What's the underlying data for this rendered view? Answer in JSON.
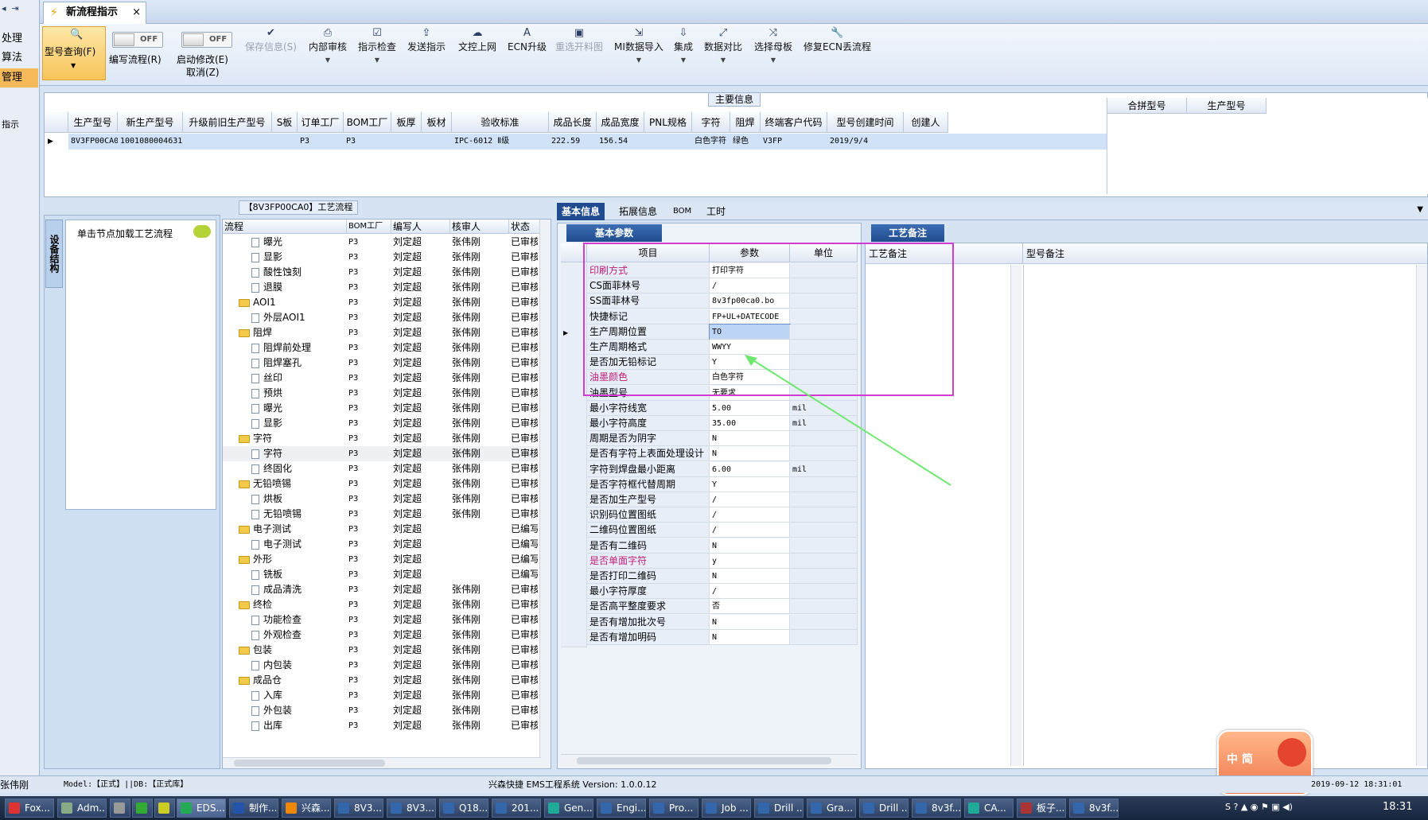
{
  "left_strip": [
    "处理",
    "算法",
    "管理",
    "指示"
  ],
  "tab": {
    "title": "新流程指示",
    "close": "×"
  },
  "toolbar": {
    "query": "型号查询(F)",
    "write_flow": "编写流程(R)",
    "start_modify": "启动修改(E)",
    "cancel": "取消(Z)",
    "off": "OFF",
    "save": "保存信息(S)",
    "internal_review": "内部审核",
    "check": "指示检查",
    "send": "发送指示",
    "upload": "文控上网",
    "ecn": "ECN升级",
    "reselect": "重选开料图",
    "mi_import": "MI数据导入",
    "integrate": "集成",
    "compare": "数据对比",
    "choose_board": "选择母板",
    "repair_ecn": "修复ECN丢流程"
  },
  "main_info": {
    "label": "主要信息",
    "headers": [
      "生产型号",
      "新生产型号",
      "升级前旧生产型号",
      "S板",
      "订单工厂",
      "BOM工厂",
      "板厚",
      "板材",
      "验收标准",
      "成品长度",
      "成品宽度",
      "PNL规格",
      "字符",
      "阻焊",
      "终端客户代码",
      "型号创建时间",
      "创建人"
    ],
    "row": [
      "8V3FP00CA0",
      "10010800046315",
      "",
      "",
      "P3",
      "P3",
      "",
      "",
      "IPC-6012 Ⅱ级",
      "222.59",
      "156.54",
      "",
      "白色字符",
      "绿色",
      "V3FP",
      "2019/9/4",
      ""
    ],
    "right_headers": [
      "合拼型号",
      "生产型号"
    ]
  },
  "tree": {
    "vtab": "设备结构",
    "node_hint": "单击节点加载工艺流程"
  },
  "flow": {
    "title": "【8V3FP00CA0】工艺流程",
    "headers": [
      "流程",
      "BOM工厂",
      "编写人",
      "核审人",
      "状态"
    ],
    "rows": [
      {
        "name": "曝光",
        "type": "doc",
        "bom": "P3",
        "writer": "刘定超",
        "checker": "张伟刚",
        "state": "已审核"
      },
      {
        "name": "显影",
        "type": "doc",
        "bom": "P3",
        "writer": "刘定超",
        "checker": "张伟刚",
        "state": "已审核"
      },
      {
        "name": "酸性蚀刻",
        "type": "doc",
        "bom": "P3",
        "writer": "刘定超",
        "checker": "张伟刚",
        "state": "已审核"
      },
      {
        "name": "退膜",
        "type": "doc",
        "bom": "P3",
        "writer": "刘定超",
        "checker": "张伟刚",
        "state": "已审核"
      },
      {
        "name": "AOI1",
        "type": "folder",
        "bom": "P3",
        "writer": "刘定超",
        "checker": "张伟刚",
        "state": "已审核"
      },
      {
        "name": "外层AOI1",
        "type": "doc",
        "bom": "P3",
        "writer": "刘定超",
        "checker": "张伟刚",
        "state": "已审核"
      },
      {
        "name": "阻焊",
        "type": "folder",
        "bom": "P3",
        "writer": "刘定超",
        "checker": "张伟刚",
        "state": "已审核"
      },
      {
        "name": "阻焊前处理",
        "type": "doc",
        "bom": "P3",
        "writer": "刘定超",
        "checker": "张伟刚",
        "state": "已审核"
      },
      {
        "name": "阻焊塞孔",
        "type": "doc",
        "bom": "P3",
        "writer": "刘定超",
        "checker": "张伟刚",
        "state": "已审核"
      },
      {
        "name": "丝印",
        "type": "doc",
        "bom": "P3",
        "writer": "刘定超",
        "checker": "张伟刚",
        "state": "已审核"
      },
      {
        "name": "预烘",
        "type": "doc",
        "bom": "P3",
        "writer": "刘定超",
        "checker": "张伟刚",
        "state": "已审核"
      },
      {
        "name": "曝光",
        "type": "doc",
        "bom": "P3",
        "writer": "刘定超",
        "checker": "张伟刚",
        "state": "已审核"
      },
      {
        "name": "显影",
        "type": "doc",
        "bom": "P3",
        "writer": "刘定超",
        "checker": "张伟刚",
        "state": "已审核"
      },
      {
        "name": "字符",
        "type": "folder",
        "bom": "P3",
        "writer": "刘定超",
        "checker": "张伟刚",
        "state": "已审核"
      },
      {
        "name": "字符",
        "type": "doc",
        "bom": "P3",
        "writer": "刘定超",
        "checker": "张伟刚",
        "state": "已审核"
      },
      {
        "name": "终固化",
        "type": "doc",
        "bom": "P3",
        "writer": "刘定超",
        "checker": "张伟刚",
        "state": "已审核"
      },
      {
        "name": "无铅喷锡",
        "type": "folder",
        "bom": "P3",
        "writer": "刘定超",
        "checker": "张伟刚",
        "state": "已审核"
      },
      {
        "name": "烘板",
        "type": "doc",
        "bom": "P3",
        "writer": "刘定超",
        "checker": "张伟刚",
        "state": "已审核"
      },
      {
        "name": "无铅喷锡",
        "type": "doc",
        "bom": "P3",
        "writer": "刘定超",
        "checker": "张伟刚",
        "state": "已审核"
      },
      {
        "name": "电子测试",
        "type": "folder",
        "bom": "P3",
        "writer": "刘定超",
        "checker": "",
        "state": "已编写"
      },
      {
        "name": "电子测试",
        "type": "doc",
        "bom": "P3",
        "writer": "刘定超",
        "checker": "",
        "state": "已编写"
      },
      {
        "name": "外形",
        "type": "folder",
        "bom": "P3",
        "writer": "刘定超",
        "checker": "",
        "state": "已编写"
      },
      {
        "name": "铣板",
        "type": "doc",
        "bom": "P3",
        "writer": "刘定超",
        "checker": "",
        "state": "已编写"
      },
      {
        "name": "成品清洗",
        "type": "doc",
        "bom": "P3",
        "writer": "刘定超",
        "checker": "张伟刚",
        "state": "已审核"
      },
      {
        "name": "终检",
        "type": "folder",
        "bom": "P3",
        "writer": "刘定超",
        "checker": "张伟刚",
        "state": "已审核"
      },
      {
        "name": "功能检查",
        "type": "doc",
        "bom": "P3",
        "writer": "刘定超",
        "checker": "张伟刚",
        "state": "已审核"
      },
      {
        "name": "外观检查",
        "type": "doc",
        "bom": "P3",
        "writer": "刘定超",
        "checker": "张伟刚",
        "state": "已审核"
      },
      {
        "name": "包装",
        "type": "folder",
        "bom": "P3",
        "writer": "刘定超",
        "checker": "张伟刚",
        "state": "已审核"
      },
      {
        "name": "内包装",
        "type": "doc",
        "bom": "P3",
        "writer": "刘定超",
        "checker": "张伟刚",
        "state": "已审核"
      },
      {
        "name": "成品仓",
        "type": "folder",
        "bom": "P3",
        "writer": "刘定超",
        "checker": "张伟刚",
        "state": "已审核"
      },
      {
        "name": "入库",
        "type": "doc",
        "bom": "P3",
        "writer": "刘定超",
        "checker": "张伟刚",
        "state": "已审核"
      },
      {
        "name": "外包装",
        "type": "doc",
        "bom": "P3",
        "writer": "刘定超",
        "checker": "张伟刚",
        "state": "已审核"
      },
      {
        "name": "出库",
        "type": "doc",
        "bom": "P3",
        "writer": "刘定超",
        "checker": "张伟刚",
        "state": "已审核"
      }
    ]
  },
  "info_tabs": [
    "基本信息",
    "拓展信息",
    "BOM",
    "工时"
  ],
  "basic": {
    "header": "基本参数",
    "cols": [
      "项目",
      "参数",
      "单位"
    ],
    "rows": [
      {
        "k": "印刷方式",
        "v": "打印字符",
        "u": "",
        "pink": true
      },
      {
        "k": "CS面菲林号",
        "v": "/",
        "u": ""
      },
      {
        "k": "SS面菲林号",
        "v": "8v3fp00ca0.bo",
        "u": ""
      },
      {
        "k": "快捷标记",
        "v": "FP+UL+DATECODE",
        "u": ""
      },
      {
        "k": "生产周期位置",
        "v": "TO",
        "u": "",
        "sel": true
      },
      {
        "k": "生产周期格式",
        "v": "WWYY",
        "u": ""
      },
      {
        "k": "是否加无铅标记",
        "v": "Y",
        "u": ""
      },
      {
        "k": "油墨颜色",
        "v": "白色字符",
        "u": "",
        "pink": true
      },
      {
        "k": "油墨型号",
        "v": "无要求",
        "u": ""
      },
      {
        "k": "最小字符线宽",
        "v": "5.00",
        "u": "mil"
      },
      {
        "k": "最小字符高度",
        "v": "35.00",
        "u": "mil"
      },
      {
        "k": "周期是否为阴字",
        "v": "N",
        "u": ""
      },
      {
        "k": "是否有字符上表面处理设计",
        "v": "N",
        "u": ""
      },
      {
        "k": "字符到焊盘最小距离",
        "v": "6.00",
        "u": "mil"
      },
      {
        "k": "是否字符框代替周期",
        "v": "Y",
        "u": ""
      },
      {
        "k": "是否加生产型号",
        "v": "/",
        "u": ""
      },
      {
        "k": "识别码位置图纸",
        "v": "/",
        "u": ""
      },
      {
        "k": "二维码位置图纸",
        "v": "/",
        "u": ""
      },
      {
        "k": "是否有二维码",
        "v": "N",
        "u": ""
      },
      {
        "k": "是否单面字符",
        "v": "y",
        "u": "",
        "pink": true
      },
      {
        "k": "是否打印二维码",
        "v": "N",
        "u": ""
      },
      {
        "k": "最小字符厚度",
        "v": "/",
        "u": ""
      },
      {
        "k": "是否高平整度要求",
        "v": "否",
        "u": ""
      },
      {
        "k": "是否有增加批次号",
        "v": "N",
        "u": ""
      },
      {
        "k": "是否有增加明码",
        "v": "N",
        "u": ""
      }
    ]
  },
  "remark": {
    "header": "工艺备注",
    "col1": "工艺备注",
    "col2": "型号备注"
  },
  "status": {
    "user": "张伟刚",
    "model": "Model:【正式】||DB:【正式库】",
    "app": "兴森快捷 EMS工程系统 Version: 1.0.0.12",
    "datetime": "2019-09-12 18:31:01"
  },
  "taskbar": {
    "items": [
      "Fox...",
      "Adm...",
      "",
      "",
      "",
      "EDS...",
      "制作...",
      "兴森...",
      "8V3...",
      "8V3...",
      "Q18...",
      "201...",
      "Gen...",
      "Engi...",
      "Pro...",
      "Job ...",
      "Drill ...",
      "Gra...",
      "Drill ...",
      "8v3f...",
      "CA...",
      "板子...",
      "8v3f..."
    ],
    "clock": "18:31"
  },
  "colors": {
    "accent": "#204c8f",
    "pink": "#c0207a",
    "highlight": "#d23cd2",
    "arrow": "#6fe86f"
  }
}
